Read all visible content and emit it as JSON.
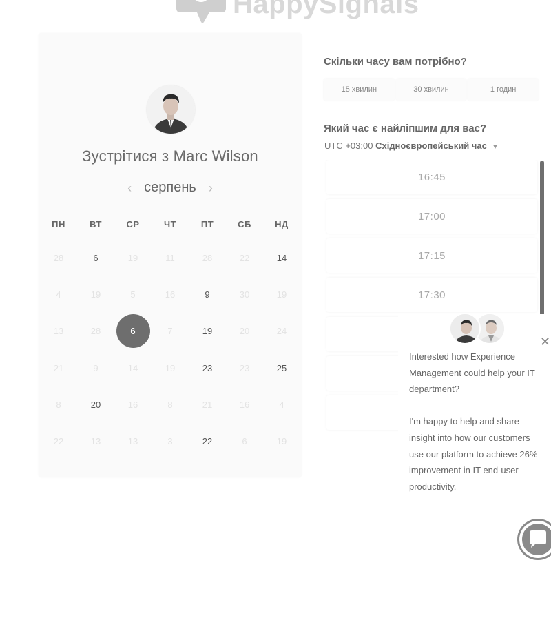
{
  "header": {
    "logo_text": "HappySignals",
    "logo_icon": "speech-bubble-icon"
  },
  "calendar": {
    "title_prefix": "Зустрітися з",
    "host_name": "Marc Wilson",
    "month": "серпень",
    "prev_icon": "chevron-left-icon",
    "next_icon": "chevron-right-icon",
    "weekdays": [
      "ПН",
      "ВТ",
      "СР",
      "ЧТ",
      "ПТ",
      "СБ",
      "НД"
    ],
    "days": [
      [
        {
          "d": "28",
          "a": false
        },
        {
          "d": "6",
          "a": true
        },
        {
          "d": "19",
          "a": false
        },
        {
          "d": "11",
          "a": false
        },
        {
          "d": "28",
          "a": false
        },
        {
          "d": "22",
          "a": false
        },
        {
          "d": "14",
          "a": true
        }
      ],
      [
        {
          "d": "4",
          "a": false
        },
        {
          "d": "19",
          "a": false
        },
        {
          "d": "5",
          "a": false
        },
        {
          "d": "16",
          "a": false
        },
        {
          "d": "9",
          "a": true
        },
        {
          "d": "30",
          "a": false
        },
        {
          "d": "19",
          "a": false
        }
      ],
      [
        {
          "d": "13",
          "a": false
        },
        {
          "d": "28",
          "a": false
        },
        {
          "d": "6",
          "a": true,
          "s": true
        },
        {
          "d": "7",
          "a": false
        },
        {
          "d": "19",
          "a": true
        },
        {
          "d": "20",
          "a": false
        },
        {
          "d": "24",
          "a": false
        }
      ],
      [
        {
          "d": "21",
          "a": false
        },
        {
          "d": "9",
          "a": false
        },
        {
          "d": "14",
          "a": false
        },
        {
          "d": "19",
          "a": false
        },
        {
          "d": "23",
          "a": true
        },
        {
          "d": "23",
          "a": false
        },
        {
          "d": "25",
          "a": true
        }
      ],
      [
        {
          "d": "8",
          "a": false
        },
        {
          "d": "20",
          "a": true
        },
        {
          "d": "16",
          "a": false
        },
        {
          "d": "8",
          "a": false
        },
        {
          "d": "21",
          "a": false
        },
        {
          "d": "16",
          "a": false
        },
        {
          "d": "4",
          "a": false
        }
      ],
      [
        {
          "d": "22",
          "a": false
        },
        {
          "d": "13",
          "a": false
        },
        {
          "d": "13",
          "a": false
        },
        {
          "d": "3",
          "a": false
        },
        {
          "d": "22",
          "a": true
        },
        {
          "d": "6",
          "a": false
        },
        {
          "d": "19",
          "a": false
        }
      ]
    ]
  },
  "duration": {
    "question": "Скільки часу вам потрібно?",
    "options": [
      "15 хвилин",
      "30 хвилин",
      "1 годин"
    ]
  },
  "time": {
    "question": "Який час є найліпшим для вас?",
    "tz_offset": "UTC +03:00",
    "tz_name": "Східноєвропейський час",
    "slots": [
      "16:45",
      "17:00",
      "17:15",
      "17:30",
      "",
      "",
      ""
    ]
  },
  "chat": {
    "message_1": "Interested how Experience Management could help your IT department?",
    "message_2": "I'm happy to help and share insight into how our customers use our platform to achieve 26% improvement in IT end-user productivity.",
    "close_icon": "close-icon",
    "launcher_icon": "chat-bubble-icon"
  }
}
